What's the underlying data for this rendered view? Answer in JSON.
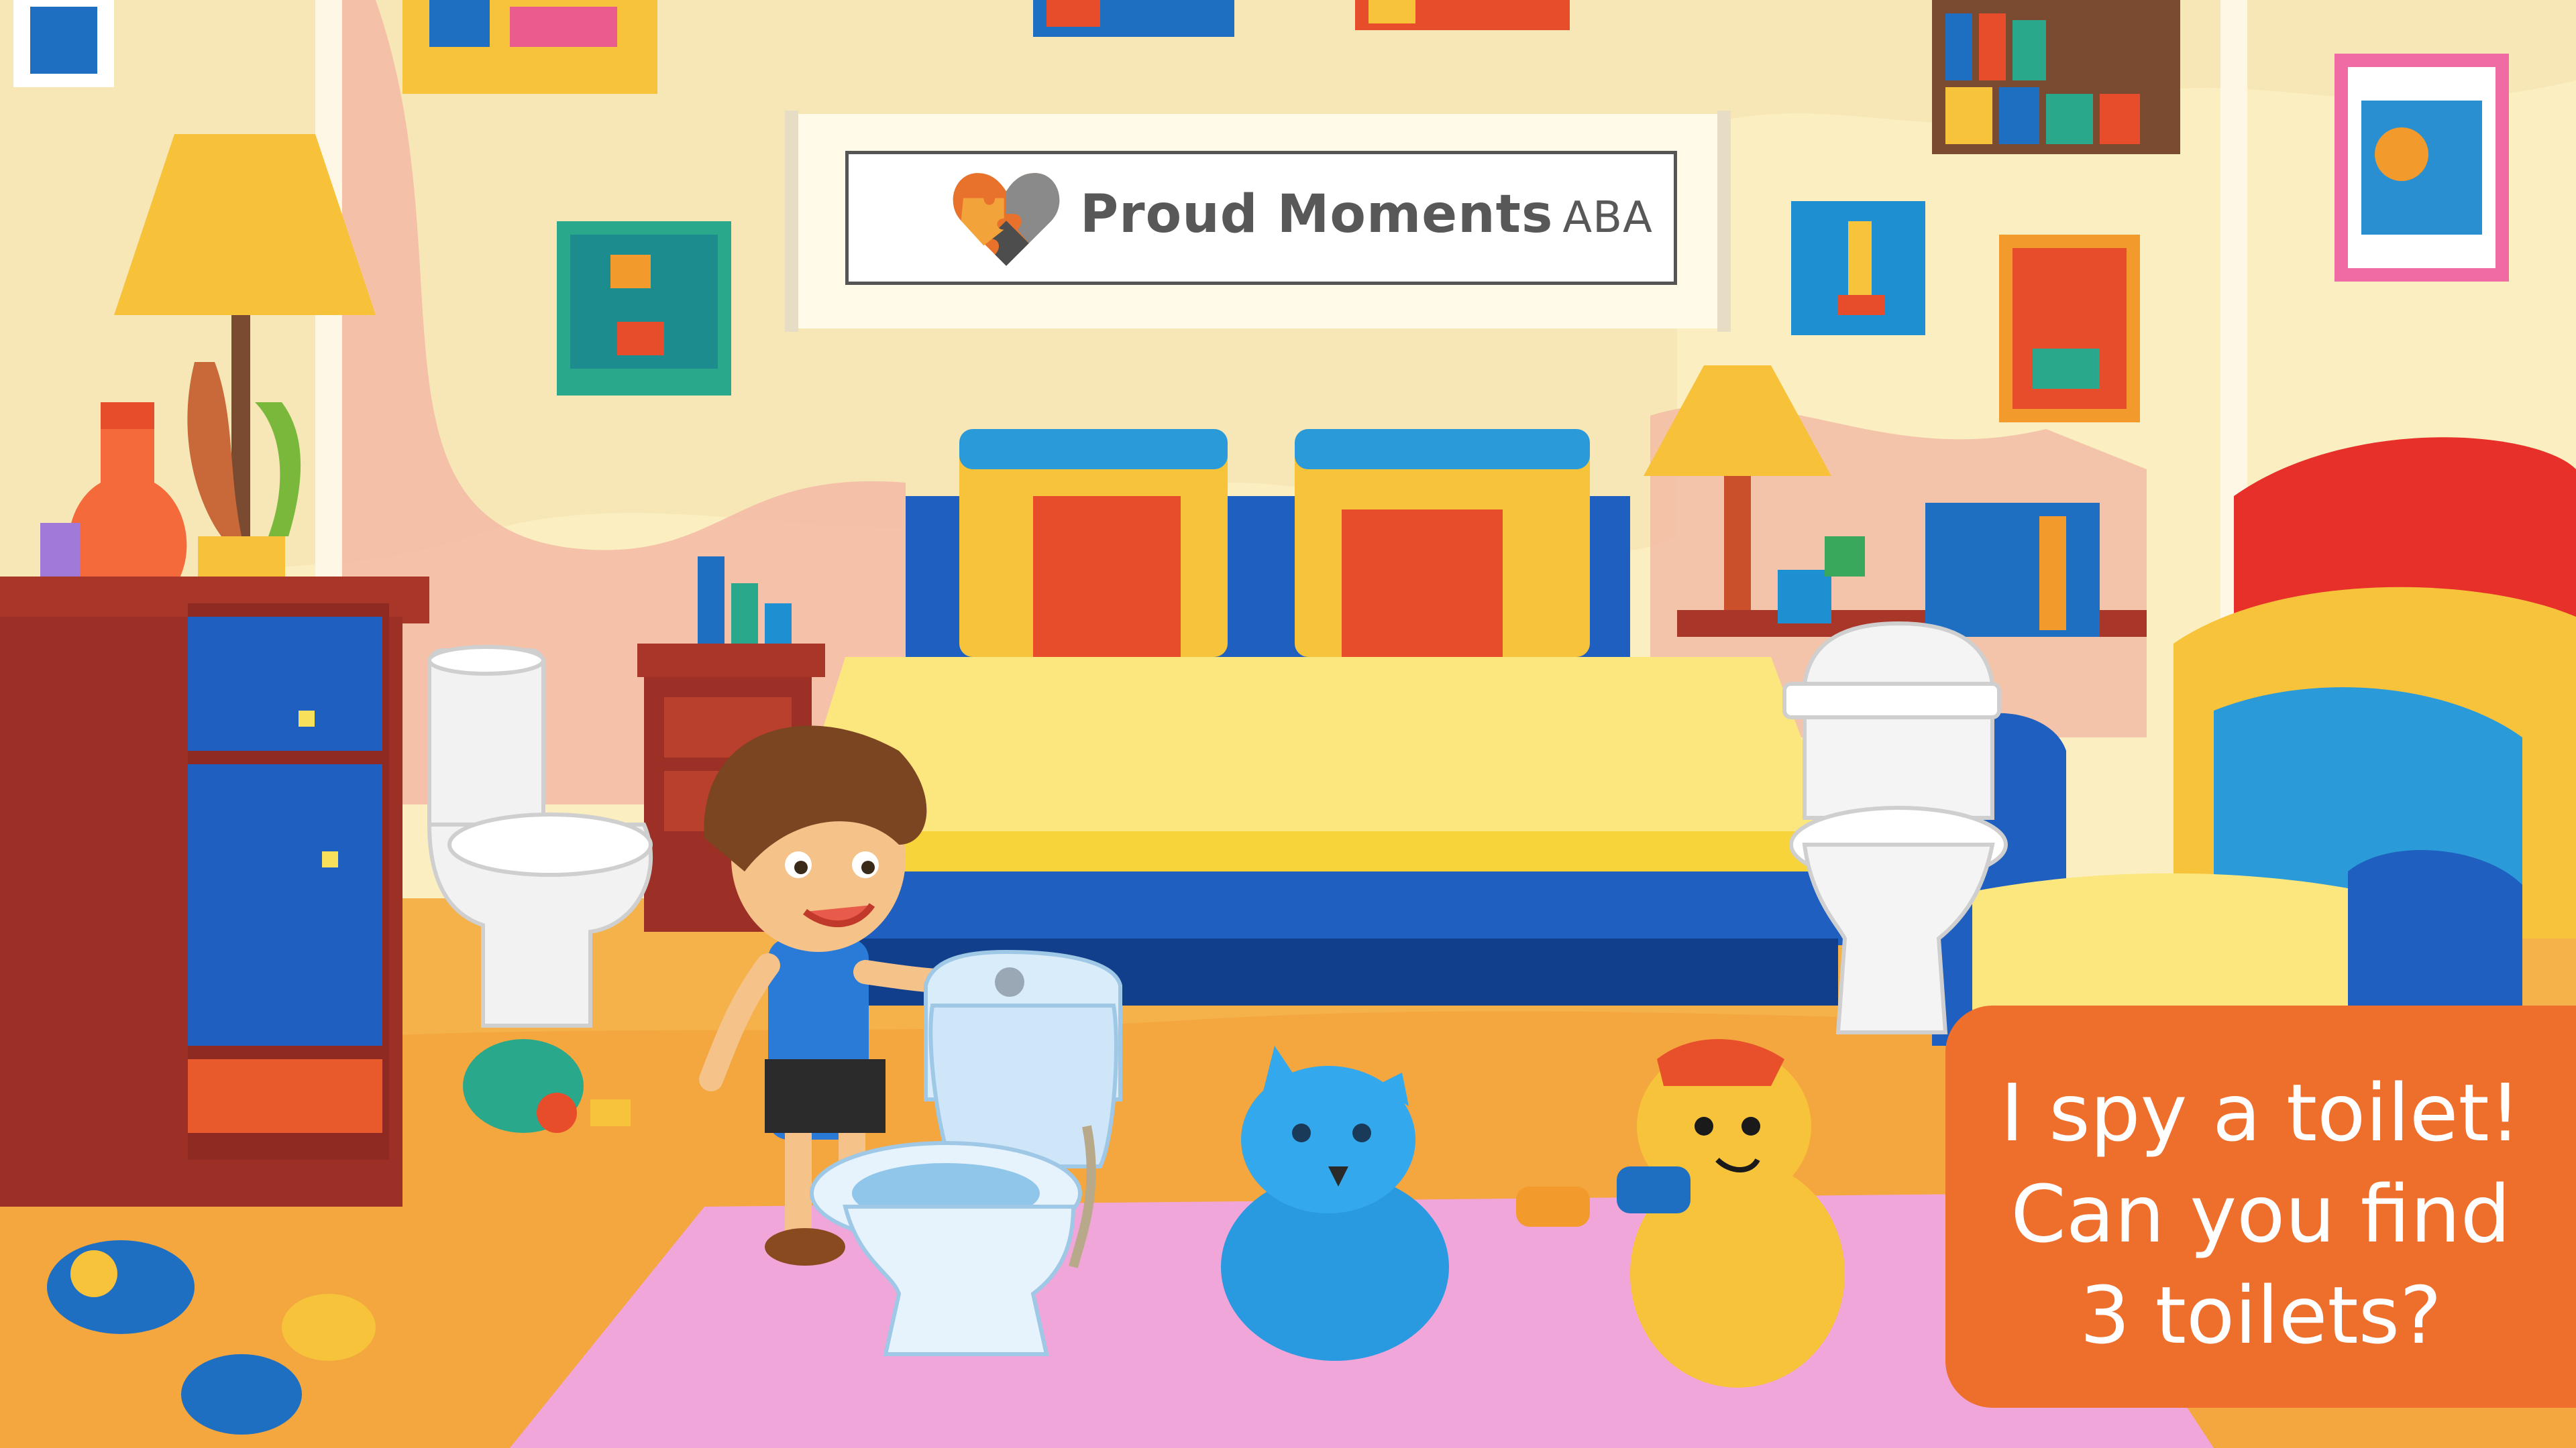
{
  "banner": {
    "brand": "Proud Moments",
    "brand_suffix": "ABA",
    "logo_icon": "heart-puzzle-icon",
    "logo_colors": [
      "#e8722c",
      "#f2a33a",
      "#4d4d4d",
      "#8a8a8a"
    ]
  },
  "prompt": {
    "lines": [
      "I spy a toilet!",
      "Can you find",
      "3 toilets?"
    ],
    "background_color": "#ee6e2c",
    "text_color": "#ffffff"
  },
  "game": {
    "target_object": "toilet",
    "target_icon": "toilet-icon",
    "hidden_items": [
      "toilet-left",
      "toilet-right",
      "toilet-front"
    ]
  }
}
